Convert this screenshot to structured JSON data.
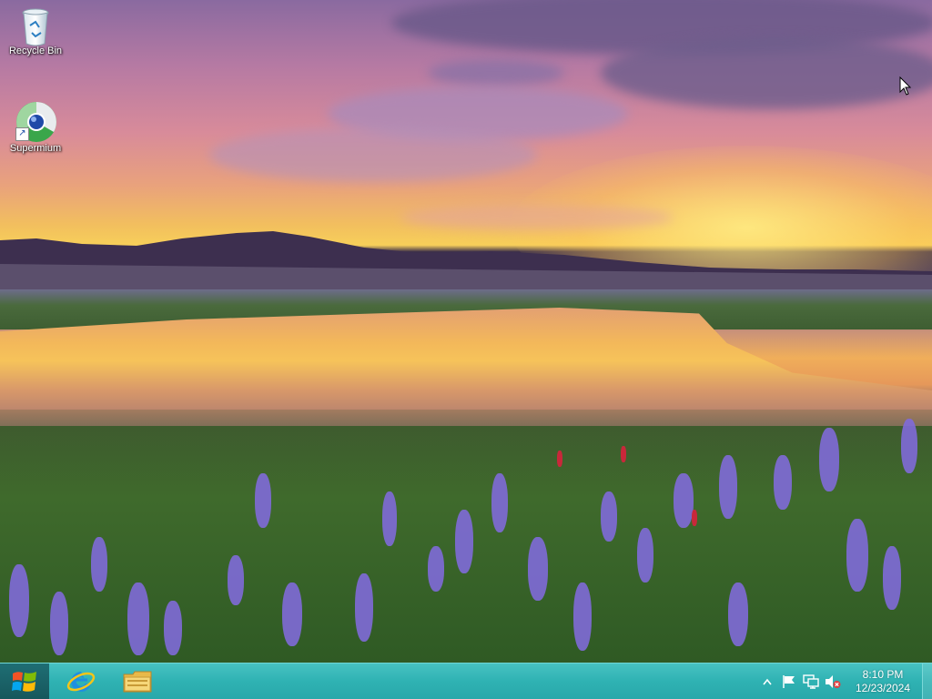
{
  "desktop": {
    "icons": [
      {
        "label": "Recycle Bin",
        "icon": "recycle-bin-icon"
      },
      {
        "label": "Supermium",
        "icon": "supermium-browser-icon",
        "shortcut": true
      }
    ]
  },
  "taskbar": {
    "start_icon": "windows-logo-icon",
    "pinned": [
      {
        "name": "Internet Explorer",
        "icon": "internet-explorer-icon"
      },
      {
        "name": "File Explorer",
        "icon": "file-explorer-icon"
      }
    ],
    "tray": {
      "icons": [
        "show-hidden-icons-chevron",
        "action-center-flag-icon",
        "network-icon",
        "volume-muted-icon"
      ],
      "time": "8:10 PM",
      "date": "12/23/2024"
    }
  },
  "colors": {
    "taskbar": "#2fb2b3",
    "start_button": "#16575c"
  }
}
